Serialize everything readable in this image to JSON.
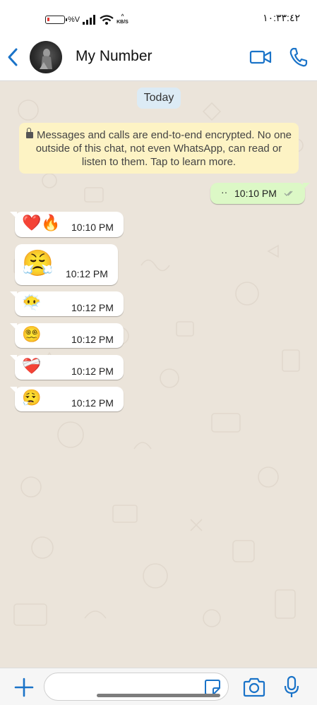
{
  "status_bar": {
    "battery_text": "%V",
    "network_speed_unit": "KB/S",
    "time": "١٠:٣٣:٤٢"
  },
  "header": {
    "contact_name": "My Number"
  },
  "chat": {
    "date_chip": "Today",
    "encryption_notice": "Messages and calls are end-to-end encrypted. No one outside of this chat, not even WhatsApp, can read or listen to them. Tap to learn more.",
    "outgoing": {
      "text": "··",
      "time": "10:10 PM",
      "status": "sent-ticks"
    },
    "incoming": [
      {
        "emoji": "❤️🔥",
        "time": "10:10 PM"
      },
      {
        "emoji": "😤",
        "time": "10:12 PM"
      },
      {
        "emoji": "😶‍🌫️",
        "time": "10:12 PM"
      },
      {
        "emoji": "😵‍💫",
        "time": "10:12 PM"
      },
      {
        "emoji": "❤️‍🩹",
        "time": "10:12 PM"
      },
      {
        "emoji": "😮‍💨",
        "time": "10:12 PM"
      }
    ]
  },
  "input_bar": {
    "placeholder": ""
  },
  "colors": {
    "accent": "#1a73c8",
    "outgoing_bubble": "#dcf8c6",
    "incoming_bubble": "#ffffff",
    "notice_bg": "#fdf3c4",
    "chip_bg": "#dcebf5",
    "chat_bg": "#ebe4da"
  },
  "icons": {
    "back": "chevron-left-icon",
    "video": "video-camera-icon",
    "call": "phone-icon",
    "plus": "plus-icon",
    "sticker": "sticker-icon",
    "camera": "camera-icon",
    "mic": "microphone-icon"
  }
}
